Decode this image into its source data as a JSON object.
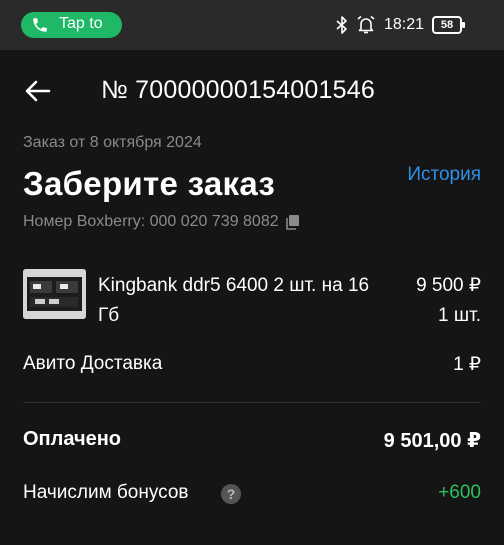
{
  "status_bar": {
    "tap_label": "Tap to",
    "time": "18:21",
    "battery": "58",
    "icons": [
      "bluetooth-icon",
      "alarm-icon"
    ]
  },
  "header": {
    "back_icon": "arrow-left-icon",
    "order_number": "№ 70000000154001546"
  },
  "order": {
    "date": "Заказ от 8 октября 2024",
    "status": "Заберите заказ",
    "history_link": "История",
    "tracking": "Номер Boxberry: 000 020 739 8082"
  },
  "product": {
    "name": "Kingbank ddr5 6400 2 шт. на 16 Гб",
    "price": "9 500 ₽",
    "qty": "1 шт."
  },
  "delivery": {
    "label": "Авито Доставка",
    "price": "1 ₽"
  },
  "summary": {
    "paid_label": "Оплачено",
    "paid_total": "9 501,00 ₽",
    "bonus_label": "Начислим бонусов",
    "bonus_value": "+600"
  },
  "colors": {
    "accent_link": "#2f8fe8",
    "bonus_green": "#2fbf5f",
    "call_pill": "#1fb866"
  }
}
